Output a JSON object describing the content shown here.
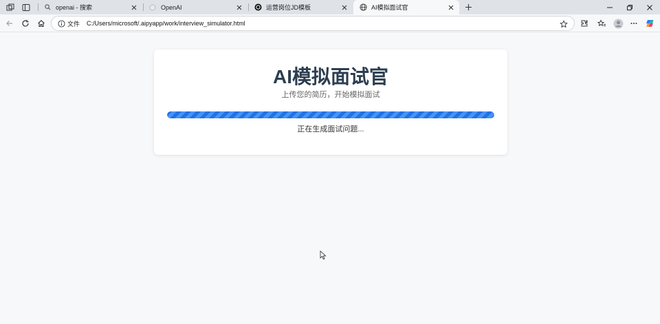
{
  "browser": {
    "tabs": [
      {
        "title": "openai - 搜索",
        "icon": "search-icon",
        "active": false
      },
      {
        "title": "OpenAI",
        "icon": "circle-icon",
        "active": false
      },
      {
        "title": "运营岗位JD模板",
        "icon": "openai-logo-icon",
        "active": false
      },
      {
        "title": "AI模拟面试官",
        "icon": "globe-icon",
        "active": true
      }
    ],
    "address": {
      "label": "文件",
      "url": "C:/Users/microsoft/.aipyapp/work/interview_simulator.html"
    }
  },
  "page": {
    "title": "AI模拟面试官",
    "subtitle": "上传您的简历，开始模拟面试",
    "progress": 1.0,
    "status": "正在生成面试问题..."
  },
  "colors": {
    "accent": "#1e73e8",
    "title": "#2c3e50",
    "background": "#f7f8fa"
  }
}
